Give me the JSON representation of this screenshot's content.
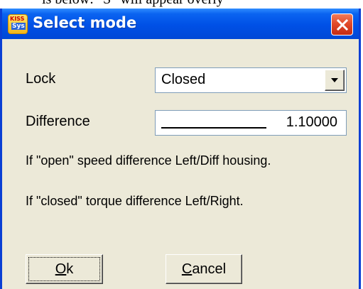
{
  "background_text": {
    "fragment": "is below: \"S\" will appear overly"
  },
  "window": {
    "title": "Select mode",
    "icon": "kisssoft-app-icon",
    "icon_top_text": "KISS",
    "icon_bottom_text": "Sys",
    "close_icon": "close-icon"
  },
  "form": {
    "lock_label": "Lock",
    "lock_value": "Closed",
    "difference_label": "Difference",
    "difference_value": "1.10000"
  },
  "info": {
    "line1": "If \"open\" speed difference Left/Diff housing.",
    "line2": "If \"closed\" torque difference Left/Right."
  },
  "buttons": {
    "ok": {
      "accelerator": "O",
      "rest": "k"
    },
    "cancel": {
      "accelerator": "C",
      "rest": "ancel"
    }
  },
  "colors": {
    "titlebar_blue": "#0a63f0",
    "dialog_background": "#ece9d8",
    "close_red": "#e24b2a",
    "input_border": "#7f9db9"
  }
}
